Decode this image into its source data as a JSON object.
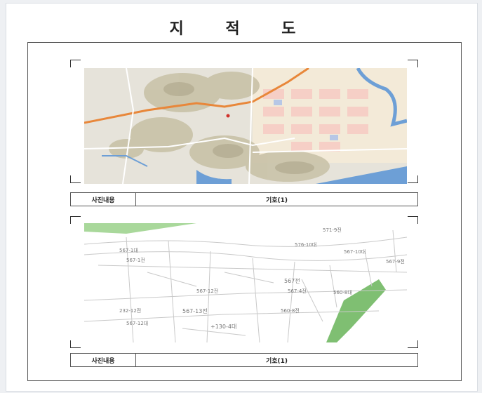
{
  "page": {
    "title": "지 적 도"
  },
  "panels": [
    {
      "caption_label": "사진내용",
      "caption_value": "기호(1)",
      "image": "aerial-terrain-map"
    },
    {
      "caption_label": "사진내용",
      "caption_value": "기호(1)",
      "image": "cadastral-parcel-map"
    }
  ],
  "cadastral_labels": [
    "571-9전",
    "576-10대",
    "567-1대",
    "567-10대",
    "567-9전",
    "567-1전",
    "567전",
    "567-4전",
    "560-8대",
    "567-12전",
    "232-12전",
    "567-13전",
    "+130-4대",
    "567-12대",
    "560-8전"
  ],
  "colors": {
    "road_orange": "#e8873a",
    "water_blue": "#6d9fd6",
    "forest_green": "#7fbf72",
    "relief_tan": "#c9c2a8"
  }
}
